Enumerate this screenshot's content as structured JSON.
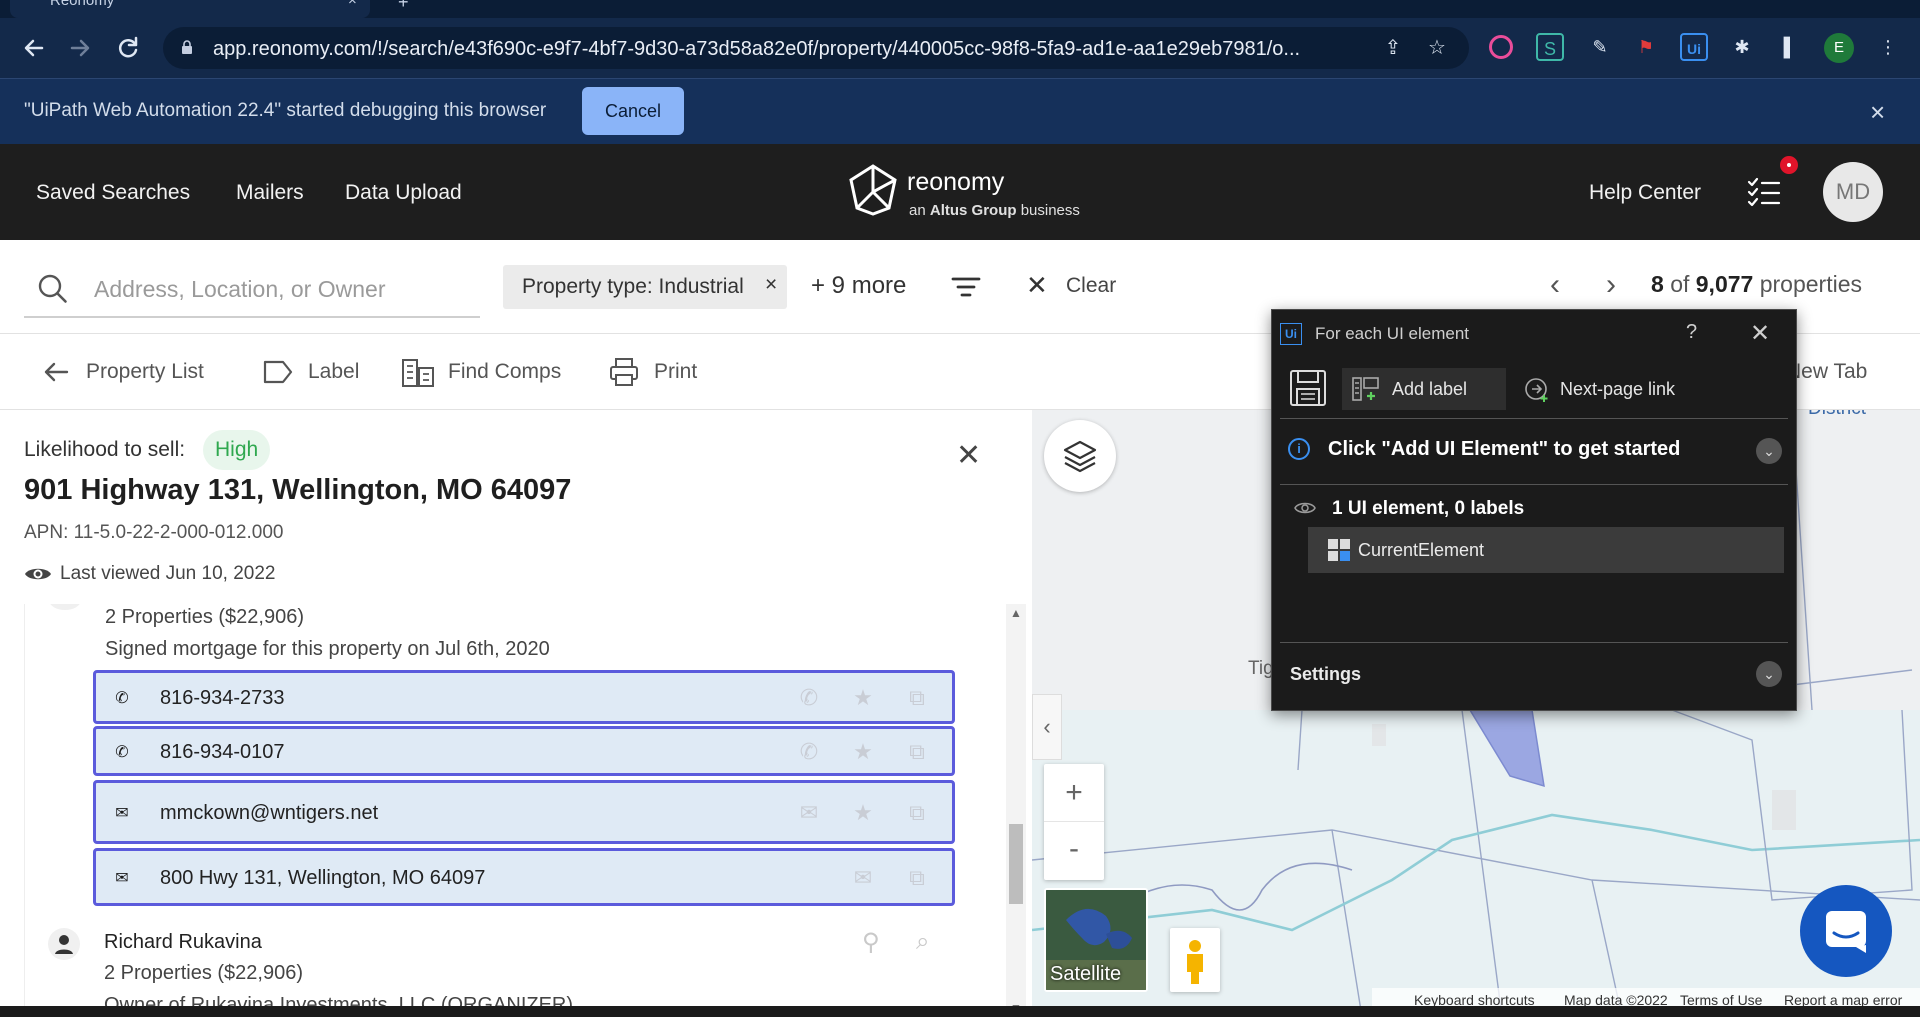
{
  "browser": {
    "tab_title": "Reonomy",
    "url": "app.reonomy.com/!/search/e43f690c-e9f7-4bf7-9d30-a73d58a82e0f/property/440005cc-98f8-5fa9-ad1e-aa1e29eb7981/o...",
    "profile_initial": "E",
    "infobar_text": "\"UiPath Web Automation 22.4\" started debugging this browser",
    "infobar_cancel": "Cancel"
  },
  "header": {
    "nav": [
      "Saved Searches",
      "Mailers",
      "Data Upload"
    ],
    "logo_word": "reonomy",
    "logo_sub_prefix": "an ",
    "logo_sub_brand": "Altus Group",
    "logo_sub_suffix": " business",
    "help_center": "Help Center",
    "avatar_initials": "MD"
  },
  "search": {
    "placeholder": "Address, Location, or Owner",
    "filter_chip": "Property type: Industrial",
    "chip_remove": "×",
    "more_filters": "+ 9 more",
    "clear_label": "Clear",
    "pager_current": "8",
    "pager_of": "of",
    "pager_total": "9,077",
    "pager_unit": "properties"
  },
  "actions": {
    "property_list": "Property List",
    "label": "Label",
    "find_comps": "Find Comps",
    "print": "Print",
    "new_tab": "New Tab"
  },
  "property": {
    "likelihood_label": "Likelihood to sell:",
    "likelihood_value": "High",
    "address": "901 Highway 131, Wellington, MO 64097",
    "apn": "APN: 11-5.0-22-2-000-012.000",
    "last_viewed": "Last viewed Jun 10, 2022"
  },
  "owners": {
    "first_properties": "2 Properties ($22,906)",
    "first_note": "Signed mortgage for this property on Jul 6th, 2020",
    "contacts": [
      {
        "type": "phone",
        "value": "816-934-2733"
      },
      {
        "type": "phone",
        "value": "816-934-0107"
      },
      {
        "type": "email",
        "value": "mmckown@wntigers.net"
      },
      {
        "type": "mail",
        "value": "800 Hwy 131, Wellington, MO 64097"
      }
    ],
    "second_name": "Richard Rukavina",
    "second_properties": "2 Properties ($22,906)",
    "second_note": "Owner of Rukavina Investments, LLC (ORGANIZER)"
  },
  "map": {
    "district_label": "District",
    "town_label": "Tig",
    "zoom_in": "+",
    "zoom_out": "-",
    "satellite": "Satellite",
    "footer": [
      "Keyboard shortcuts",
      "Map data ©2022",
      "Terms of Use",
      "Report a map error"
    ]
  },
  "uipath": {
    "title": "For each UI element",
    "help": "?",
    "add_label": "Add label",
    "next_page": "Next-page link",
    "hint": "Click \"Add UI Element\" to get started",
    "count": "1 UI element, 0 labels",
    "element": "CurrentElement",
    "settings": "Settings"
  },
  "colors": {
    "browser_bg": "#13294a",
    "app_header": "#1e1e1e",
    "likelihood_green": "#2fa84f",
    "contact_border": "#5b5bdc",
    "uipath_accent": "#3a8ff0",
    "chat_blue": "#1557c0"
  },
  "icons": [
    "back-arrow-icon",
    "forward-arrow-icon",
    "reload-icon",
    "lock-icon",
    "share-icon",
    "star-icon",
    "puzzle-icon",
    "sidebar-icon",
    "kebab-icon",
    "search-icon",
    "filter-icon",
    "close-icon",
    "chevron-left-icon",
    "chevron-right-icon",
    "label-icon",
    "find-comps-icon",
    "print-icon",
    "eye-icon",
    "phone-icon",
    "email-icon",
    "mailbox-icon",
    "copy-icon",
    "layers-icon",
    "pegman-icon",
    "chat-icon",
    "save-icon",
    "info-icon"
  ]
}
